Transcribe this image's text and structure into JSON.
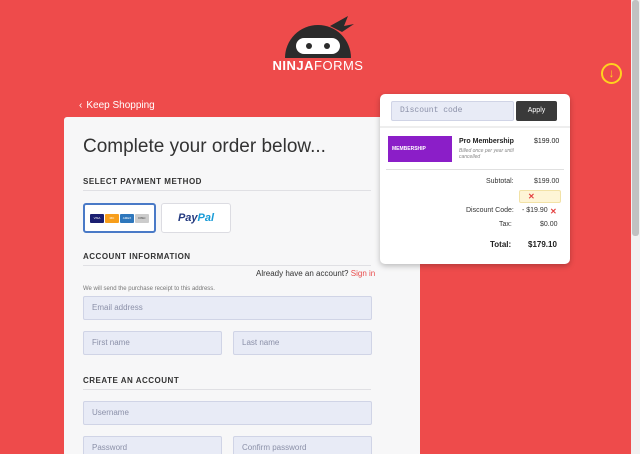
{
  "brand": {
    "logo_bold": "NINJA",
    "logo_light": "FORMS"
  },
  "nav": {
    "keep_shopping": "Keep Shopping"
  },
  "checkout": {
    "heading": "Complete your order below...",
    "payment_section": "SELECT PAYMENT METHOD",
    "payment_methods": [
      {
        "name": "credit-card",
        "card_labels": [
          "VISA",
          "MC",
          "AMEX",
          "DISC"
        ],
        "selected": true
      },
      {
        "name": "paypal",
        "label_a": "Pay",
        "label_b": "Pal",
        "selected": false
      }
    ],
    "account_section": "ACCOUNT INFORMATION",
    "have_account": "Already have an account?",
    "sign_in": "Sign in",
    "receipt_note": "We will send the purchase receipt to this address.",
    "email_placeholder": "Email address",
    "first_name_placeholder": "First name",
    "last_name_placeholder": "Last name",
    "create_section": "CREATE AN ACCOUNT",
    "username_placeholder": "Username",
    "password_placeholder": "Password",
    "confirm_password_placeholder": "Confirm password"
  },
  "summary": {
    "discount_placeholder": "Discount code",
    "apply": "Apply",
    "product": {
      "thumb_label": "MEMBERSHIP",
      "name": "Pro Membership",
      "description": "Billed once per year until cancelled",
      "price": "$199.00"
    },
    "subtotal_label": "Subtotal:",
    "subtotal_value": "$199.00",
    "coupon_remove": "✕",
    "discount_label": "Discount Code:",
    "discount_value": "- $19.90",
    "tax_label": "Tax:",
    "tax_value": "$0.00",
    "total_label": "Total:",
    "total_value": "$179.10"
  },
  "colors": {
    "background": "#ee4b4b",
    "accent_yellow": "#ffd21f",
    "product_purple": "#8b1ec8"
  }
}
